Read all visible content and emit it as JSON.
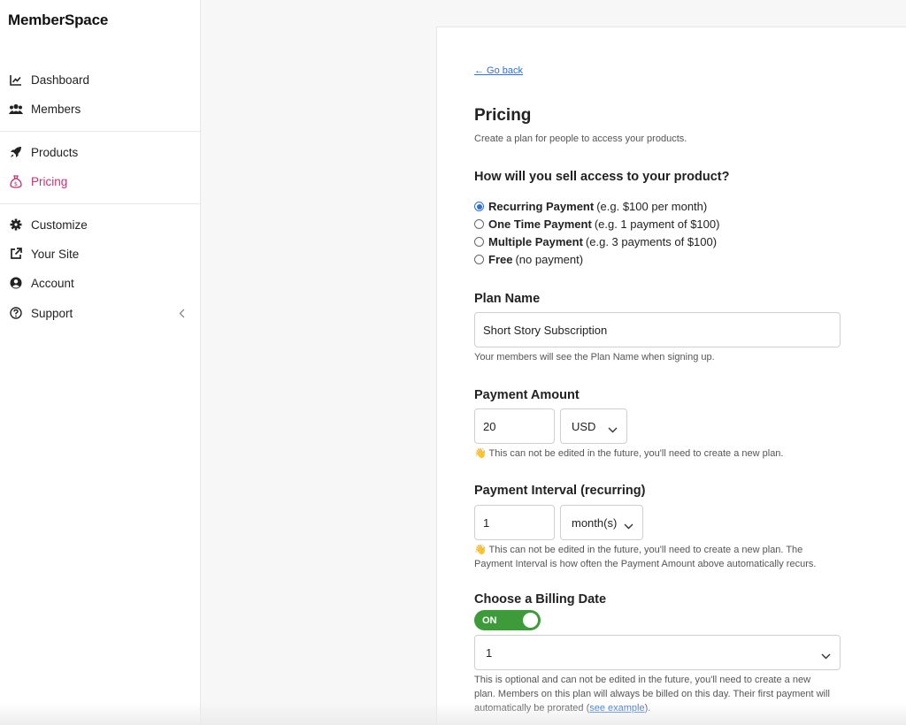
{
  "app": {
    "logo": "MemberSpace"
  },
  "sidebar": {
    "items": [
      {
        "label": "Dashboard",
        "icon": "chart-line-icon"
      },
      {
        "label": "Members",
        "icon": "users-icon"
      },
      {
        "label": "Products",
        "icon": "rocket-icon"
      },
      {
        "label": "Pricing",
        "icon": "money-bag-icon",
        "active": true
      },
      {
        "label": "Customize",
        "icon": "gear-icon"
      },
      {
        "label": "Your Site",
        "icon": "external-link-icon"
      },
      {
        "label": "Account",
        "icon": "user-circle-icon"
      },
      {
        "label": "Support",
        "icon": "question-circle-icon"
      }
    ]
  },
  "main": {
    "go_back": "← Go back",
    "title": "Pricing",
    "subtitle": "Create a plan for people to access your products.",
    "sell_question": "How will you sell access to your product?",
    "payment_options": [
      {
        "name": "Recurring Payment",
        "detail": "(e.g. $100 per month)",
        "selected": true
      },
      {
        "name": "One Time Payment",
        "detail": "(e.g. 1 payment of $100)",
        "selected": false
      },
      {
        "name": "Multiple Payment",
        "detail": "(e.g. 3 payments of $100)",
        "selected": false
      },
      {
        "name": "Free",
        "detail": "(no payment)",
        "selected": false
      }
    ],
    "plan_name": {
      "label": "Plan Name",
      "value": "Short Story Subscription",
      "hint": "Your members will see the Plan Name when signing up."
    },
    "payment_amount": {
      "label": "Payment Amount",
      "value": "20",
      "currency": "USD",
      "hint": "👋 This can not be edited in the future, you'll need to create a new plan."
    },
    "payment_interval": {
      "label": "Payment Interval (recurring)",
      "value": "1",
      "unit": "month(s)",
      "hint_line1": "👋 This can not be edited in the future, you'll need to create a new plan. The",
      "hint_line2": "Payment Interval is how often the Payment Amount above automatically recurs."
    },
    "billing_date": {
      "label": "Choose a Billing Date",
      "toggle": "ON",
      "value": "1",
      "hint_line1": "This is optional and can not be edited in the future, you'll need to create a new",
      "hint_line2": "plan. Members on this plan will always be billed on this day. Their first payment will",
      "hint_line3_pre": "automatically be prorated (",
      "hint_link": "see example",
      "hint_line3_post": ")."
    }
  },
  "colors": {
    "accent": "#c2336f",
    "link": "#2f6fd0",
    "toggle_on": "#3e9b3a"
  }
}
